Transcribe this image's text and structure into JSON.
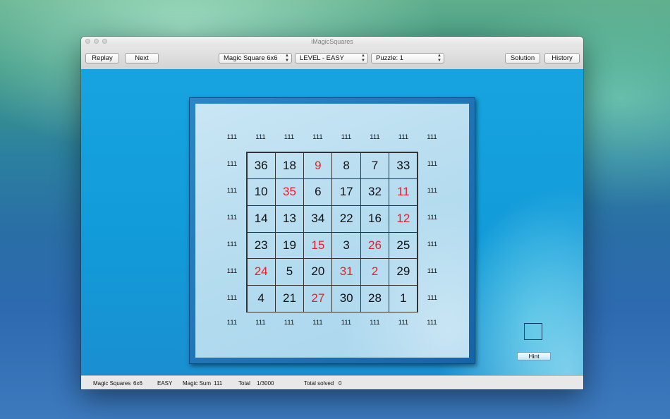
{
  "window": {
    "title": "iMagicSquares"
  },
  "toolbar": {
    "replay_label": "Replay",
    "next_label": "Next",
    "square_select": "Magic Square 6x6",
    "level_select": "LEVEL - EASY",
    "puzzle_select": "Puzzle: 1",
    "solution_label": "Solution",
    "history_label": "History"
  },
  "board": {
    "top_sums": [
      "111",
      "111",
      "111",
      "111",
      "111",
      "111",
      "111",
      "111"
    ],
    "left_sums": [
      "111",
      "111",
      "111",
      "111",
      "111",
      "111"
    ],
    "right_sums": [
      "111",
      "111",
      "111",
      "111",
      "111",
      "111"
    ],
    "bottom_sums": [
      "111",
      "111",
      "111",
      "111",
      "111",
      "111",
      "111",
      "111"
    ],
    "cells": [
      [
        "36",
        "18",
        "9",
        "8",
        "7",
        "33"
      ],
      [
        "10",
        "35",
        "6",
        "17",
        "32",
        "11"
      ],
      [
        "14",
        "13",
        "34",
        "22",
        "16",
        "12"
      ],
      [
        "23",
        "19",
        "15",
        "3",
        "26",
        "25"
      ],
      [
        "24",
        "5",
        "20",
        "31",
        "2",
        "29"
      ],
      [
        "4",
        "21",
        "27",
        "30",
        "28",
        "1"
      ]
    ],
    "given_color": "#111111",
    "entered_color": "#e8202a",
    "entered_cells": [
      [
        0,
        2
      ],
      [
        1,
        1
      ],
      [
        1,
        5
      ],
      [
        2,
        5
      ],
      [
        3,
        2
      ],
      [
        3,
        4
      ],
      [
        4,
        0
      ],
      [
        4,
        3
      ],
      [
        4,
        4
      ],
      [
        5,
        2
      ]
    ]
  },
  "hint": {
    "label": "Hint"
  },
  "status": {
    "app_label": "Magic Squares",
    "size": "6x6",
    "level": "EASY",
    "magic_sum_label": "Magic Sum",
    "magic_sum": "111",
    "total_label": "Total",
    "total": "1/3000",
    "solved_label": "Total solved",
    "solved": "0"
  }
}
